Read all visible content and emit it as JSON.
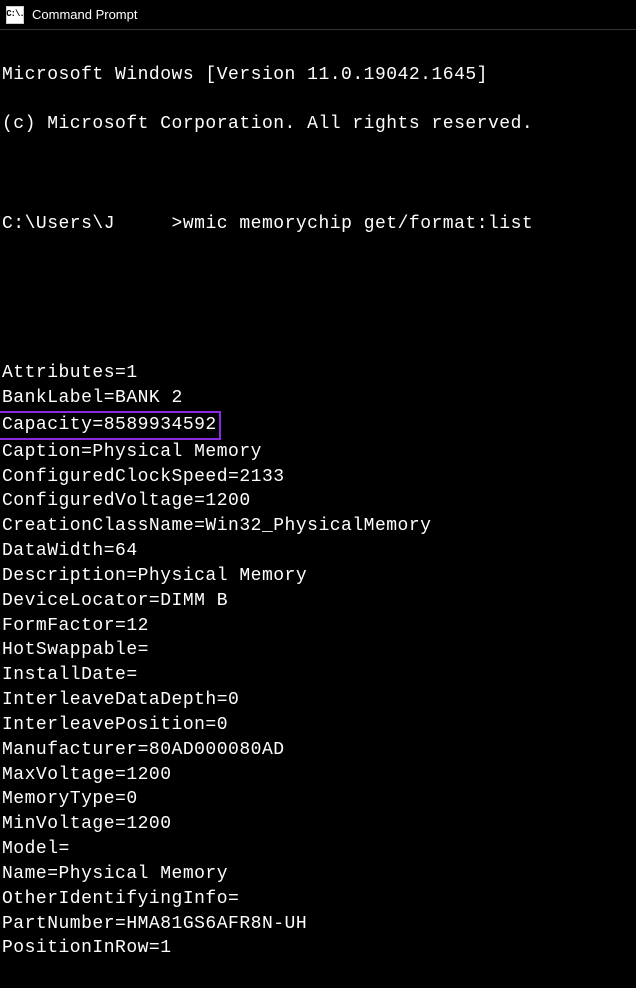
{
  "window": {
    "title": "Command Prompt",
    "icon_text": "C:\\."
  },
  "banner": {
    "line1": "Microsoft Windows [Version 11.0.19042.1645]",
    "line2": "(c) Microsoft Corporation. All rights reserved."
  },
  "prompt": {
    "path": "C:\\Users\\J",
    "spacer": "     ",
    "marker": ">",
    "command": "wmic memorychip get/format:list"
  },
  "output": {
    "lines": [
      "Attributes=1",
      "BankLabel=BANK 2",
      "Capacity=8589934592",
      "Caption=Physical Memory",
      "ConfiguredClockSpeed=2133",
      "ConfiguredVoltage=1200",
      "CreationClassName=Win32_PhysicalMemory",
      "DataWidth=64",
      "Description=Physical Memory",
      "DeviceLocator=DIMM B",
      "FormFactor=12",
      "HotSwappable=",
      "InstallDate=",
      "InterleaveDataDepth=0",
      "InterleavePosition=0",
      "Manufacturer=80AD000080AD",
      "MaxVoltage=1200",
      "MemoryType=0",
      "MinVoltage=1200",
      "Model=",
      "Name=Physical Memory",
      "OtherIdentifyingInfo=",
      "PartNumber=HMA81GS6AFR8N-UH",
      "PositionInRow=1"
    ],
    "highlighted_index": 2
  }
}
